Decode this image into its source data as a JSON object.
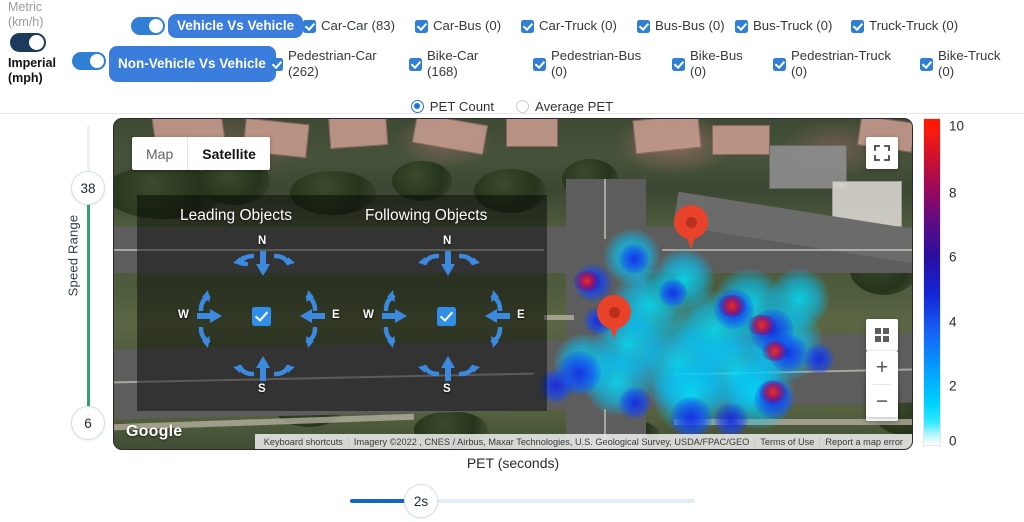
{
  "units": {
    "metric_label": "Metric\n(km/h)",
    "metric_line1": "Metric",
    "metric_line2": "(km/h)",
    "imperial_line1": "Imperial",
    "imperial_line2": "(mph)",
    "selected": "Imperial (mph)"
  },
  "groups": [
    {
      "toggle_on": true,
      "pill_label": "Vehicle Vs Vehicle",
      "items": [
        {
          "label": "Car-Car (83)",
          "checked": true,
          "count": 83
        },
        {
          "label": "Car-Bus (0)",
          "checked": true,
          "count": 0
        },
        {
          "label": "Car-Truck (0)",
          "checked": true,
          "count": 0
        },
        {
          "label": "Bus-Bus (0)",
          "checked": true,
          "count": 0
        },
        {
          "label": "Bus-Truck (0)",
          "checked": true,
          "count": 0
        },
        {
          "label": "Truck-Truck (0)",
          "checked": true,
          "count": 0
        }
      ]
    },
    {
      "toggle_on": true,
      "pill_label": "Non-Vehicle Vs Vehicle",
      "items": [
        {
          "label": "Pedestrian-Car\n(262)",
          "checked": true,
          "count": 262
        },
        {
          "label": "Bike-Car\n(168)",
          "checked": true,
          "count": 168
        },
        {
          "label": "Pedestrian-Bus\n(0)",
          "checked": true,
          "count": 0
        },
        {
          "label": "Bike-Bus\n(0)",
          "checked": true,
          "count": 0
        },
        {
          "label": "Pedestrian-Truck\n(0)",
          "checked": true,
          "count": 0
        },
        {
          "label": "Bike-Truck\n(0)",
          "checked": true,
          "count": 0
        }
      ]
    }
  ],
  "metric_mode": {
    "options": [
      "PET Count",
      "Average PET"
    ],
    "selected": "PET Count"
  },
  "speed_range": {
    "label": "Speed Range",
    "max_value": "38",
    "min_value": "6",
    "track_color": "#2ea565"
  },
  "map": {
    "type_options": [
      "Map",
      "Satellite"
    ],
    "type_selected": "Satellite",
    "brand": "Google",
    "attribution": [
      "Keyboard shortcuts",
      "Imagery ©2022 , CNES / Airbus, Maxar Technologies, U.S. Geological Survey, USDA/FPAC/GEO",
      "Terms of Use",
      "Report a map error"
    ],
    "controls": {
      "fullscreen": "fullscreen-icon",
      "layers": "grid-layers-icon",
      "pegman": "street-view-pegman-icon",
      "zoom_in": "+",
      "zoom_out": "−"
    },
    "overlay": {
      "leading_title": "Leading Objects",
      "following_title": "Following Objects",
      "directions": [
        "N",
        "E",
        "S",
        "W"
      ],
      "center_checked": true
    }
  },
  "chart_data": {
    "type": "heatmap",
    "title": "",
    "xlabel": "PET (seconds)",
    "ylabel": "",
    "colorbar": {
      "label": "PET (seconds)",
      "ticks": [
        "0",
        "2",
        "4",
        "6",
        "8",
        "10"
      ],
      "min": 0,
      "max": 10,
      "colormap_stops": [
        "#ffffff",
        "#00d4ff",
        "#1566f5",
        "#1326d8",
        "#5a0c86",
        "#d3122a",
        "#ff1500"
      ]
    },
    "metric": "PET Count",
    "series": [
      {
        "name": "Car-Car",
        "values": [
          83
        ]
      },
      {
        "name": "Car-Bus",
        "values": [
          0
        ]
      },
      {
        "name": "Car-Truck",
        "values": [
          0
        ]
      },
      {
        "name": "Bus-Bus",
        "values": [
          0
        ]
      },
      {
        "name": "Bus-Truck",
        "values": [
          0
        ]
      },
      {
        "name": "Truck-Truck",
        "values": [
          0
        ]
      },
      {
        "name": "Pedestrian-Car",
        "values": [
          262
        ]
      },
      {
        "name": "Bike-Car",
        "values": [
          168
        ]
      },
      {
        "name": "Pedestrian-Bus",
        "values": [
          0
        ]
      },
      {
        "name": "Bike-Bus",
        "values": [
          0
        ]
      },
      {
        "name": "Pedestrian-Truck",
        "values": [
          0
        ]
      },
      {
        "name": "Bike-Truck",
        "values": [
          0
        ]
      }
    ],
    "categories": [
      "Car-Car",
      "Car-Bus",
      "Car-Truck",
      "Bus-Bus",
      "Bus-Truck",
      "Truck-Truck",
      "Pedestrian-Car",
      "Bike-Car",
      "Pedestrian-Bus",
      "Bike-Bus",
      "Pedestrian-Truck",
      "Bike-Truck"
    ],
    "values": [
      83,
      0,
      0,
      0,
      0,
      0,
      262,
      168,
      0,
      0,
      0,
      0
    ],
    "speed_filter": [
      6,
      38
    ],
    "pet_threshold_seconds": 2
  },
  "colorbar_ticks": [
    {
      "label": "10",
      "pos": 4
    },
    {
      "label": "8",
      "pos": 70
    },
    {
      "label": "6",
      "pos": 134
    },
    {
      "label": "4",
      "pos": 199
    },
    {
      "label": "2",
      "pos": 263
    },
    {
      "label": "0",
      "pos": 324
    }
  ],
  "axis_title": "PET (seconds)",
  "pet_slider": {
    "value_label": "2s",
    "value": 2,
    "min": 0,
    "max": 10
  }
}
